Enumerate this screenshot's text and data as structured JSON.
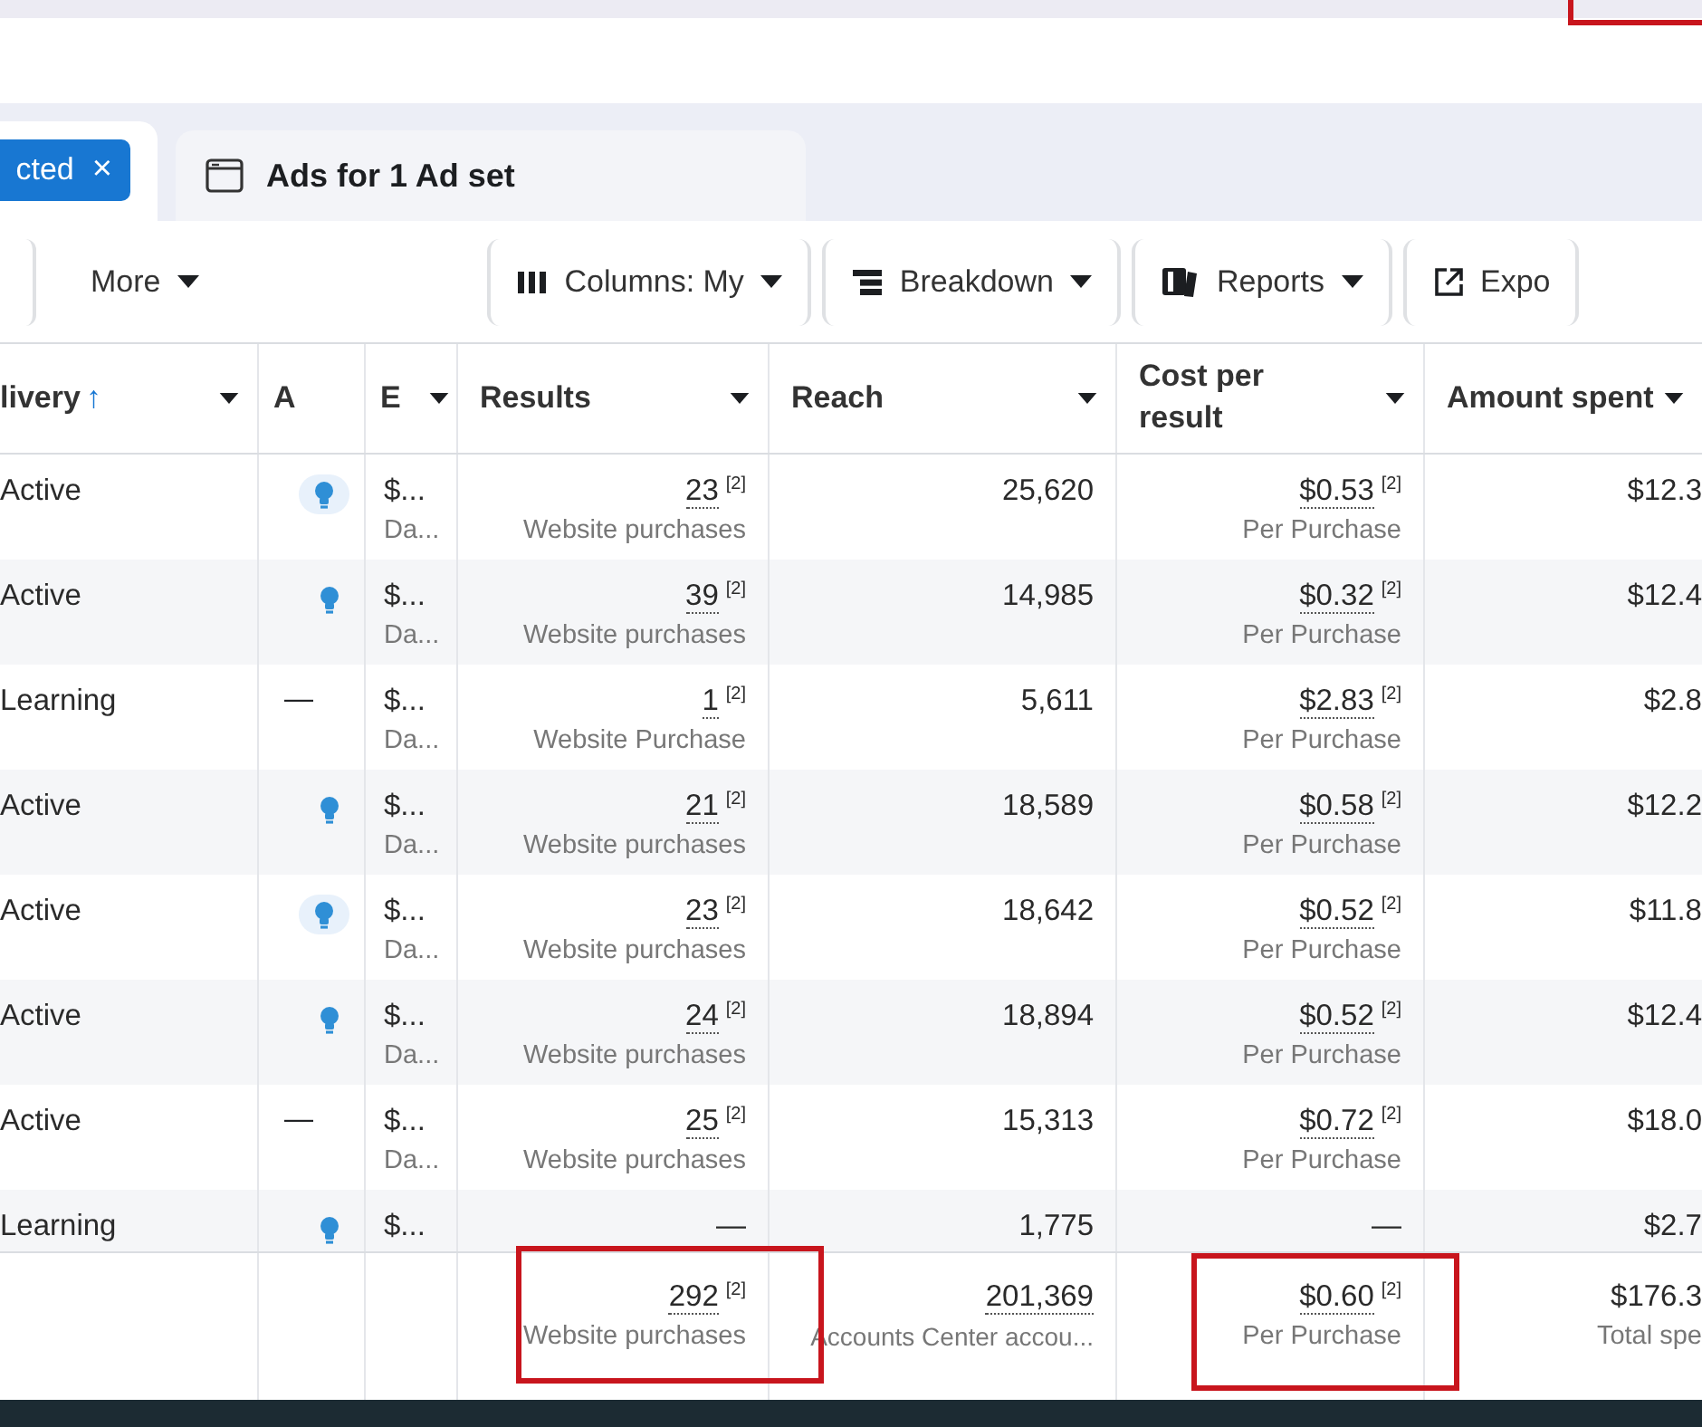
{
  "tabs": [
    {
      "label": "cted",
      "kind": "filter",
      "selected": true,
      "close": "×"
    },
    {
      "label": "Ads for 1 Ad set",
      "kind": "view",
      "selected": false
    }
  ],
  "toolbar": {
    "buttons": [
      {
        "label": "More",
        "kind": "plain"
      },
      {
        "label": "Columns: My",
        "kind": "columns"
      },
      {
        "label": "Breakdown",
        "kind": "breakdown"
      },
      {
        "label": "Reports",
        "kind": "reports"
      },
      {
        "label": "Expo",
        "kind": "export"
      }
    ]
  },
  "table": {
    "columns": [
      {
        "label": "livery",
        "sort_arrow": "↑"
      },
      {
        "label": "A"
      },
      {
        "label": "E"
      },
      {
        "label": "Results"
      },
      {
        "label": "Reach"
      },
      {
        "label": "Cost per result"
      },
      {
        "label": "Amount spent"
      }
    ],
    "rows": [
      {
        "delivery": "Active",
        "insight": true,
        "b": "$...",
        "b_sub": "Da...",
        "results": "23",
        "results_note": "[2]",
        "results_sub": "Website purchases",
        "reach": "25,620",
        "cost": "$0.53",
        "cost_note": "[2]",
        "cost_sub": "Per Purchase",
        "spent": "$12.3"
      },
      {
        "delivery": "Active",
        "insight": true,
        "b": "$...",
        "b_sub": "Da...",
        "results": "39",
        "results_note": "[2]",
        "results_sub": "Website purchases",
        "reach": "14,985",
        "cost": "$0.32",
        "cost_note": "[2]",
        "cost_sub": "Per Purchase",
        "spent": "$12.4"
      },
      {
        "delivery": "Learning",
        "insight": false,
        "a": "—",
        "b": "$...",
        "b_sub": "Da...",
        "results": "1",
        "results_note": "[2]",
        "results_sub": "Website Purchase",
        "reach": "5,611",
        "cost": "$2.83",
        "cost_note": "[2]",
        "cost_sub": "Per Purchase",
        "spent": "$2.8"
      },
      {
        "delivery": "Active",
        "insight": true,
        "b": "$...",
        "b_sub": "Da...",
        "results": "21",
        "results_note": "[2]",
        "results_sub": "Website purchases",
        "reach": "18,589",
        "cost": "$0.58",
        "cost_note": "[2]",
        "cost_sub": "Per Purchase",
        "spent": "$12.2"
      },
      {
        "delivery": "Active",
        "insight": true,
        "b": "$...",
        "b_sub": "Da...",
        "results": "23",
        "results_note": "[2]",
        "results_sub": "Website purchases",
        "reach": "18,642",
        "cost": "$0.52",
        "cost_note": "[2]",
        "cost_sub": "Per Purchase",
        "spent": "$11.8"
      },
      {
        "delivery": "Active",
        "insight": true,
        "b": "$...",
        "b_sub": "Da...",
        "results": "24",
        "results_note": "[2]",
        "results_sub": "Website purchases",
        "reach": "18,894",
        "cost": "$0.52",
        "cost_note": "[2]",
        "cost_sub": "Per Purchase",
        "spent": "$12.4"
      },
      {
        "delivery": "Active",
        "insight": false,
        "a": "—",
        "b": "$...",
        "b_sub": "Da...",
        "results": "25",
        "results_note": "[2]",
        "results_sub": "Website purchases",
        "reach": "15,313",
        "cost": "$0.72",
        "cost_note": "[2]",
        "cost_sub": "Per Purchase",
        "spent": "$18.0"
      },
      {
        "delivery": "Learning",
        "insight": true,
        "b": "$...",
        "results": "—",
        "reach": "1,775",
        "cost": "—",
        "spent": "$2.7"
      }
    ],
    "footer": {
      "results": "292",
      "results_note": "[2]",
      "results_sub": "Website purchases",
      "reach": "201,369",
      "reach_sub": "Accounts Center accou...",
      "cost": "$0.60",
      "cost_note": "[2]",
      "cost_sub": "Per Purchase",
      "spent": "$176.3",
      "spent_sub": "Total spe"
    }
  }
}
